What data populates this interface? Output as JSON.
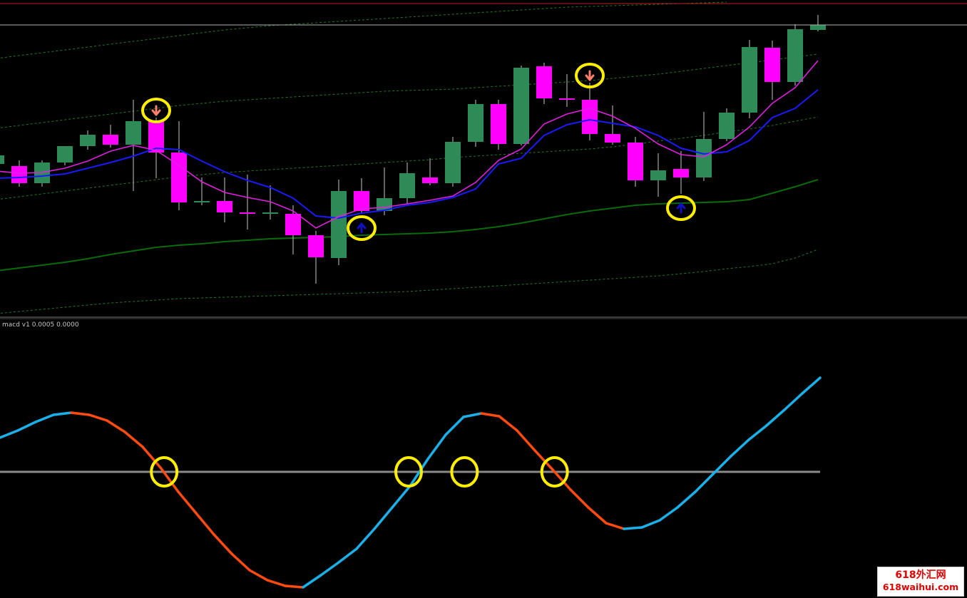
{
  "indicator_label": "macd v1 0.0005 0.0000",
  "watermark": {
    "line1": "618外汇网",
    "line2": "618waihui.com"
  },
  "colors": {
    "bull": "#2e8b57",
    "bear": "#ff00ff",
    "ma_fast": "#e020e0",
    "ma_slow": "#1a1aff",
    "ma_long": "#0b6b0b",
    "band": "#1f7a1f",
    "macd_up": "#1ab0ea",
    "macd_down": "#ff4a10",
    "zero_line": "#8a8a8a",
    "highlight": "#ffee00",
    "arrow_up": "#1010c0",
    "arrow_down": "#ff7f6a",
    "separator": "#b0b0b0"
  },
  "chart_data": [
    {
      "type": "candlestick",
      "yrange": [
        0,
        440
      ],
      "candles": [
        {
          "o": 230,
          "h": 205,
          "l": 225,
          "c": 218
        },
        {
          "o": 233,
          "h": 225,
          "l": 262,
          "c": 257
        },
        {
          "o": 257,
          "h": 225,
          "l": 262,
          "c": 228
        },
        {
          "o": 228,
          "h": 205,
          "l": 232,
          "c": 205
        },
        {
          "o": 205,
          "h": 183,
          "l": 210,
          "c": 189
        },
        {
          "o": 189,
          "h": 175,
          "l": 207,
          "c": 203
        },
        {
          "o": 203,
          "h": 140,
          "l": 268,
          "c": 170
        },
        {
          "o": 170,
          "h": 165,
          "l": 250,
          "c": 214
        },
        {
          "o": 214,
          "h": 170,
          "l": 295,
          "c": 284
        },
        {
          "o": 284,
          "h": 249,
          "l": 288,
          "c": 282
        },
        {
          "o": 282,
          "h": 249,
          "l": 312,
          "c": 298
        },
        {
          "o": 298,
          "h": 245,
          "l": 322,
          "c": 300
        },
        {
          "o": 300,
          "h": 260,
          "l": 308,
          "c": 298
        },
        {
          "o": 300,
          "h": 288,
          "l": 357,
          "c": 330
        },
        {
          "o": 330,
          "h": 324,
          "l": 398,
          "c": 361
        },
        {
          "o": 362,
          "h": 252,
          "l": 372,
          "c": 268
        },
        {
          "o": 268,
          "h": 250,
          "l": 300,
          "c": 296
        },
        {
          "o": 296,
          "h": 235,
          "l": 302,
          "c": 278
        },
        {
          "o": 278,
          "h": 228,
          "l": 286,
          "c": 243
        },
        {
          "o": 249,
          "h": 222,
          "l": 260,
          "c": 257
        },
        {
          "o": 257,
          "h": 192,
          "l": 262,
          "c": 199
        },
        {
          "o": 199,
          "h": 140,
          "l": 206,
          "c": 146
        },
        {
          "o": 146,
          "h": 140,
          "l": 210,
          "c": 202
        },
        {
          "o": 202,
          "h": 92,
          "l": 204,
          "c": 95
        },
        {
          "o": 93,
          "h": 88,
          "l": 146,
          "c": 138
        },
        {
          "o": 138,
          "h": 104,
          "l": 150,
          "c": 140
        },
        {
          "o": 140,
          "h": 116,
          "l": 197,
          "c": 188
        },
        {
          "o": 188,
          "h": 148,
          "l": 203,
          "c": 200
        },
        {
          "o": 200,
          "h": 192,
          "l": 262,
          "c": 253
        },
        {
          "o": 253,
          "h": 215,
          "l": 276,
          "c": 239
        },
        {
          "o": 237,
          "h": 212,
          "l": 272,
          "c": 249
        },
        {
          "o": 249,
          "h": 157,
          "l": 254,
          "c": 195
        },
        {
          "o": 195,
          "h": 152,
          "l": 198,
          "c": 158
        },
        {
          "o": 158,
          "h": 56,
          "l": 166,
          "c": 66
        },
        {
          "o": 67,
          "h": 57,
          "l": 140,
          "c": 115
        },
        {
          "o": 115,
          "h": 34,
          "l": 120,
          "c": 41
        },
        {
          "o": 42,
          "h": 21,
          "l": 44,
          "c": 35
        }
      ],
      "ma_fast": [
        240,
        243,
        242,
        236,
        226,
        212,
        204,
        211,
        232,
        255,
        270,
        277,
        283,
        296,
        320,
        304,
        293,
        291,
        286,
        281,
        275,
        256,
        225,
        209,
        174,
        160,
        152,
        163,
        180,
        202,
        217,
        220,
        203,
        178,
        145,
        123,
        85
      ],
      "ma_slow": [
        250,
        249,
        247,
        244,
        236,
        228,
        219,
        208,
        210,
        226,
        241,
        253,
        263,
        278,
        303,
        306,
        299,
        295,
        288,
        284,
        277,
        265,
        230,
        222,
        190,
        175,
        168,
        173,
        178,
        190,
        208,
        216,
        213,
        197,
        165,
        152,
        126
      ],
      "ma_long": [
        380,
        376,
        372,
        368,
        363,
        357,
        352,
        347,
        344,
        342,
        339,
        337,
        335,
        334,
        333,
        332,
        330,
        329,
        328,
        327,
        325,
        322,
        318,
        313,
        307,
        301,
        296,
        292,
        288,
        286,
        285,
        284,
        283,
        280,
        271,
        262,
        252
      ],
      "band_top": [
        82,
        78,
        74,
        70,
        66,
        62,
        58,
        54,
        50,
        46,
        42,
        39,
        36,
        34,
        32,
        30,
        28,
        26,
        24,
        22,
        20,
        18,
        16,
        14,
        12,
        10,
        9,
        8,
        7,
        6,
        5,
        4,
        3
      ],
      "band_mid_upper": [
        180,
        176,
        172,
        168,
        164,
        160,
        156,
        152,
        148,
        145,
        142,
        140,
        138,
        136,
        134,
        132,
        130,
        128,
        127,
        126,
        125,
        123,
        121,
        119,
        117,
        115,
        113,
        110,
        107,
        104,
        100,
        96,
        92,
        88,
        84,
        80,
        76
      ],
      "band_mid_lower": [
        280,
        276,
        272,
        268,
        264,
        260,
        256,
        252,
        248,
        245,
        242,
        240,
        238,
        236,
        234,
        232,
        230,
        228,
        226,
        224,
        221,
        219,
        217,
        215,
        213,
        211,
        209,
        206,
        202,
        198,
        194,
        190,
        185,
        181,
        176,
        170,
        164
      ],
      "band_bottom": [
        440,
        437,
        434,
        431,
        428,
        425,
        423,
        421,
        419,
        418,
        417,
        416,
        415,
        414,
        413,
        412,
        411,
        410,
        409,
        407,
        405,
        403,
        401,
        399,
        397,
        395,
        393,
        391,
        389,
        387,
        384,
        381,
        377,
        374,
        370,
        362,
        350
      ],
      "signals": [
        {
          "index": 7,
          "direction": "down"
        },
        {
          "index": 16,
          "direction": "up"
        },
        {
          "index": 26,
          "direction": "down"
        },
        {
          "index": 30,
          "direction": "up"
        }
      ]
    },
    {
      "type": "line",
      "name": "macd v1 0.0005 0.0000",
      "zero_value": 0,
      "series": [
        {
          "values": [
            48,
            58,
            70,
            80,
            83,
            80,
            72,
            56,
            35,
            6,
            -28,
            -58,
            -88,
            -115,
            -138,
            -152,
            -160,
            -162,
            -145,
            -127,
            -108,
            -80,
            -50,
            -20,
            18,
            52,
            77,
            82,
            78,
            58,
            30,
            3,
            -25,
            -50,
            -72,
            -80,
            -78,
            -68,
            -50,
            -28,
            -3,
            22,
            45,
            65,
            87,
            110,
            132
          ]
        }
      ],
      "highlighted_crossings": [
        8,
        18,
        25,
        31
      ]
    }
  ]
}
